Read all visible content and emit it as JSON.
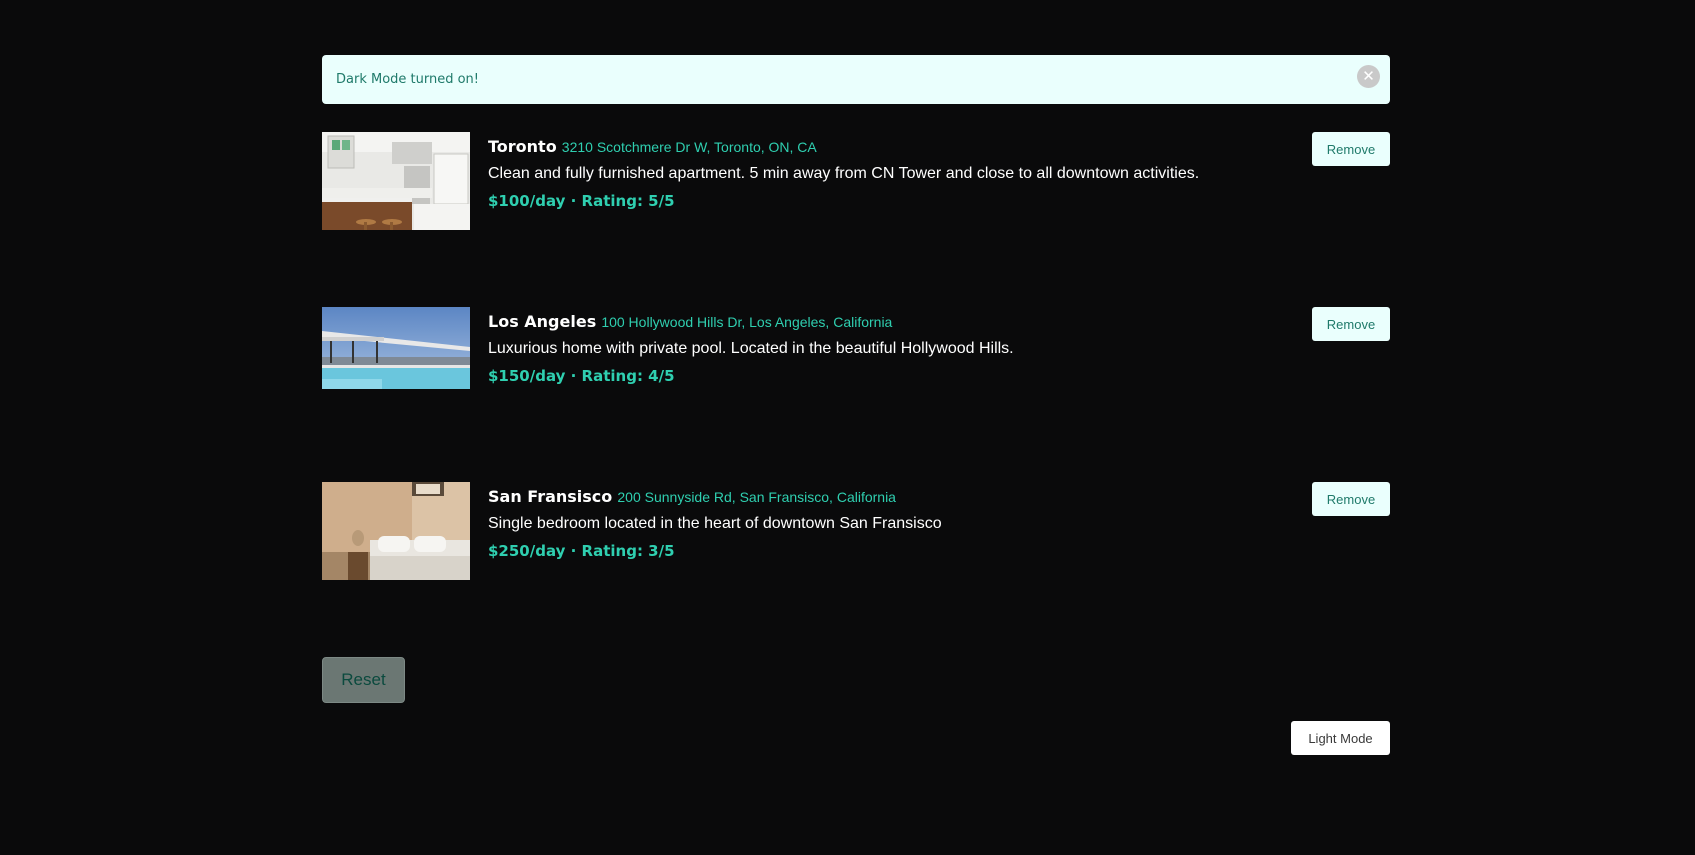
{
  "alert": {
    "message": "Dark Mode turned on!",
    "close_icon": "close-circle-icon",
    "close_glyph": "✕"
  },
  "listings": [
    {
      "city": "Toronto",
      "address": "3210 Scotchmere Dr W, Toronto, ON, CA",
      "description": "Clean and fully furnished apartment. 5 min away from CN Tower and close to all downtown activities.",
      "meta": "$100/day · Rating: 5/5",
      "remove_label": "Remove",
      "image": "kitchen-photo"
    },
    {
      "city": "Los Angeles",
      "address": "100 Hollywood Hills Dr, Los Angeles, California",
      "description": "Luxurious home with private pool. Located in the beautiful Hollywood Hills.",
      "meta": "$150/day · Rating: 4/5",
      "remove_label": "Remove",
      "image": "pool-photo"
    },
    {
      "city": "San Fransisco",
      "address": "200 Sunnyside Rd, San Fransisco, California",
      "description": "Single bedroom located in the heart of downtown San Fransisco",
      "meta": "$250/day · Rating: 3/5",
      "remove_label": "Remove",
      "image": "bedroom-photo"
    }
  ],
  "reset_label": "Reset",
  "mode_toggle_label": "Light Mode",
  "colors": {
    "background": "#0a0a0b",
    "accent": "#2fcfb0",
    "alert_background": "#eafffd"
  }
}
